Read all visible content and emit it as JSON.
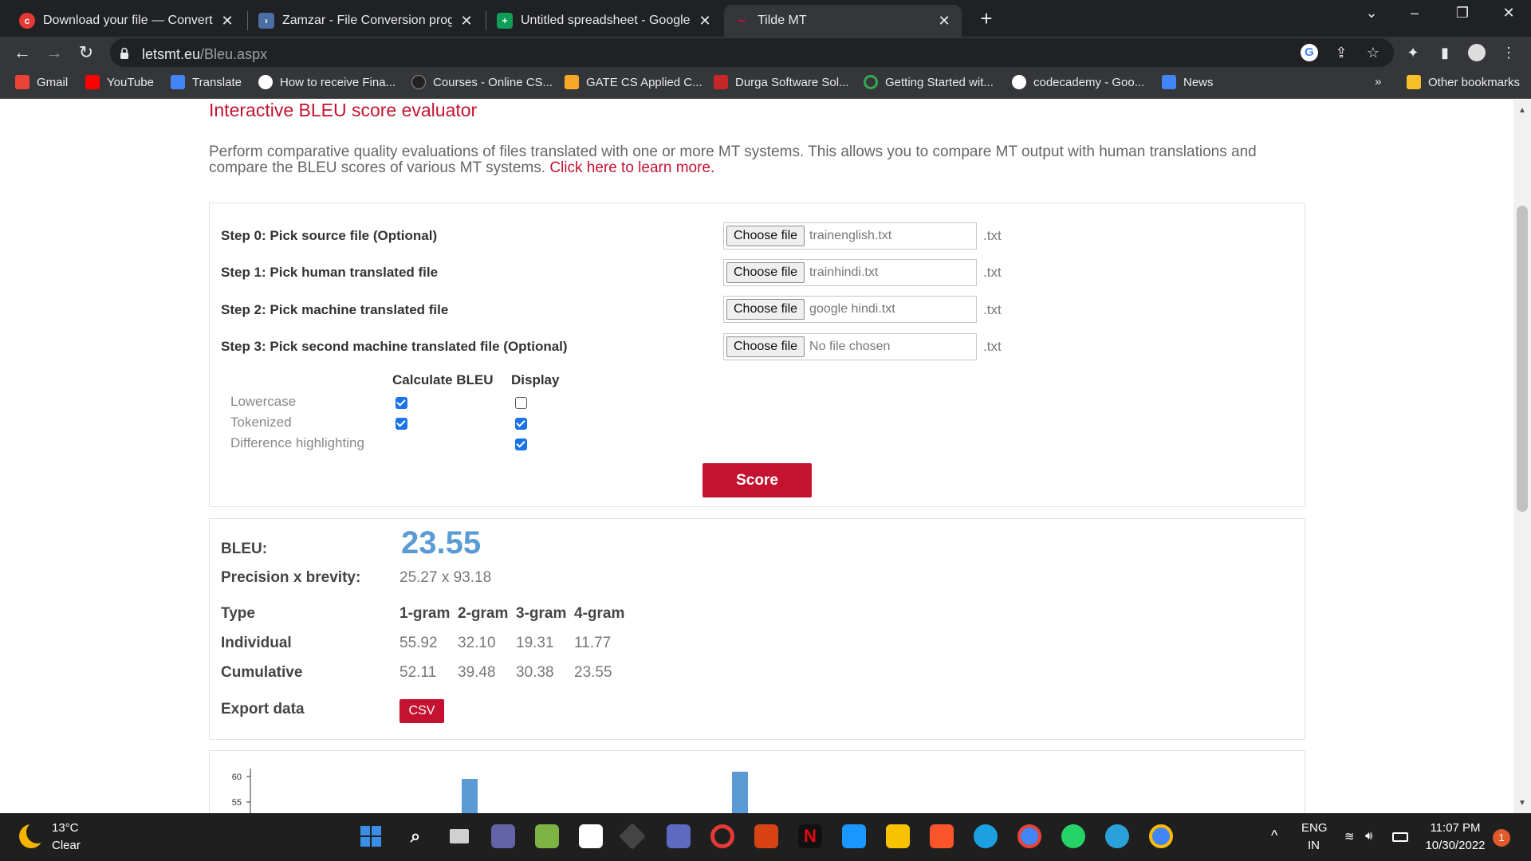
{
  "browser": {
    "tabs": [
      {
        "title": "Download your file — Convertio",
        "icon": "convertio-icon",
        "color": "#e53935"
      },
      {
        "title": "Zamzar - File Conversion progres",
        "icon": "zamzar-icon",
        "color": "#4a6fa5"
      },
      {
        "title": "Untitled spreadsheet - Google Sh",
        "icon": "sheets-icon",
        "color": "#0f9d58"
      },
      {
        "title": "Tilde MT",
        "icon": "tilde-icon",
        "color": "#c41230"
      }
    ],
    "new_tab": "+",
    "url_domain": "letsmt.eu",
    "url_path": "/Bleu.aspx",
    "bookmarks": [
      {
        "label": "Gmail",
        "icon": "gmail-icon",
        "color": "#ea4335"
      },
      {
        "label": "YouTube",
        "icon": "youtube-icon",
        "color": "#ff0000"
      },
      {
        "label": "Translate",
        "icon": "translate-icon",
        "color": "#4285f4"
      },
      {
        "label": "How to receive Fina...",
        "icon": "medium-icon",
        "color": "#ffffff"
      },
      {
        "label": "Courses - Online CS...",
        "icon": "courses-icon",
        "color": "#222222"
      },
      {
        "label": "GATE CS Applied C...",
        "icon": "gate-icon",
        "color": "#f9a825"
      },
      {
        "label": "Durga Software Sol...",
        "icon": "durga-icon",
        "color": "#c62828"
      },
      {
        "label": "Getting Started wit...",
        "icon": "getting-started-icon",
        "color": "#34a853"
      },
      {
        "label": "codecademy - Goo...",
        "icon": "google-icon",
        "color": "#4285f4"
      },
      {
        "label": "News",
        "icon": "news-icon",
        "color": "#4285f4"
      }
    ],
    "more_bookmarks": "»",
    "other_bookmarks": "Other bookmarks"
  },
  "page": {
    "heading": "Interactive BLEU score evaluator",
    "intro_text": "Perform comparative quality evaluations of files translated with one or more MT systems. This allows you to compare MT output with human translations and compare the BLEU scores of various MT systems.",
    "intro_link": "Click here to learn more."
  },
  "steps": [
    {
      "label": "Step 0: Pick source file (Optional)",
      "button": "Choose file",
      "file": "trainenglish.txt",
      "ext": ".txt"
    },
    {
      "label": "Step 1: Pick human translated file",
      "button": "Choose file",
      "file": "trainhindi.txt",
      "ext": ".txt"
    },
    {
      "label": "Step 2: Pick machine translated file",
      "button": "Choose file",
      "file": "google hindi.txt",
      "ext": ".txt"
    },
    {
      "label": "Step 3: Pick second machine translated file (Optional)",
      "button": "Choose file",
      "file": "No file chosen",
      "ext": ".txt"
    }
  ],
  "options": {
    "col_calculate": "Calculate BLEU",
    "col_display": "Display",
    "rows": [
      {
        "label": "Lowercase",
        "calculate": true,
        "display": false
      },
      {
        "label": "Tokenized",
        "calculate": true,
        "display": true
      },
      {
        "label": "Difference highlighting",
        "calculate": null,
        "display": true
      }
    ]
  },
  "score_button": "Score",
  "results": {
    "bleu_label": "BLEU:",
    "bleu_value": "23.55",
    "precision_label": "Precision x brevity:",
    "precision_value": "25.27 x 93.18",
    "type_label": "Type",
    "ngram_headers": [
      "1-gram",
      "2-gram",
      "3-gram",
      "4-gram"
    ],
    "individual_label": "Individual",
    "individual": [
      "55.92",
      "32.10",
      "19.31",
      "11.77"
    ],
    "cumulative_label": "Cumulative",
    "cumulative": [
      "52.11",
      "39.48",
      "30.38",
      "23.55"
    ],
    "export_label": "Export data",
    "csv_button": "CSV"
  },
  "chart_data": {
    "type": "bar",
    "y_ticks": [
      "60",
      "55"
    ],
    "bar_color": "#5b9bd5"
  },
  "taskbar": {
    "temperature": "13°C",
    "condition": "Clear",
    "language": "ENG",
    "region": "IN",
    "time": "11:07 PM",
    "date": "10/30/2022",
    "notifications": "1",
    "apps": [
      {
        "name": "start-icon",
        "color": "#3a8ee6"
      },
      {
        "name": "search-icon",
        "color": "#1f1f1f"
      },
      {
        "name": "task-view-icon",
        "color": "#1f1f1f"
      },
      {
        "name": "teams-chat-icon",
        "color": "#6264a7"
      },
      {
        "name": "photo-app-icon",
        "color": "#7cb342"
      },
      {
        "name": "store-icon",
        "color": "#ffffff"
      },
      {
        "name": "cube-app-icon",
        "color": "#444444"
      },
      {
        "name": "visual-studio-icon",
        "color": "#5c6bc0"
      },
      {
        "name": "opera-icon",
        "color": "#e53935"
      },
      {
        "name": "office-icon",
        "color": "#d84315"
      },
      {
        "name": "netflix-icon",
        "color": "#111111"
      },
      {
        "name": "prime-video-icon",
        "color": "#1a98ff"
      },
      {
        "name": "file-explorer-icon",
        "color": "#f9c200"
      },
      {
        "name": "brave-icon",
        "color": "#fb542b"
      },
      {
        "name": "edge-icon",
        "color": "#1ba1e2"
      },
      {
        "name": "chrome-icon",
        "color": "#4285f4"
      },
      {
        "name": "whatsapp-icon",
        "color": "#25d366"
      },
      {
        "name": "telegram-icon",
        "color": "#2aa1da"
      },
      {
        "name": "chrome-profile-icon",
        "color": "#4285f4"
      }
    ]
  }
}
